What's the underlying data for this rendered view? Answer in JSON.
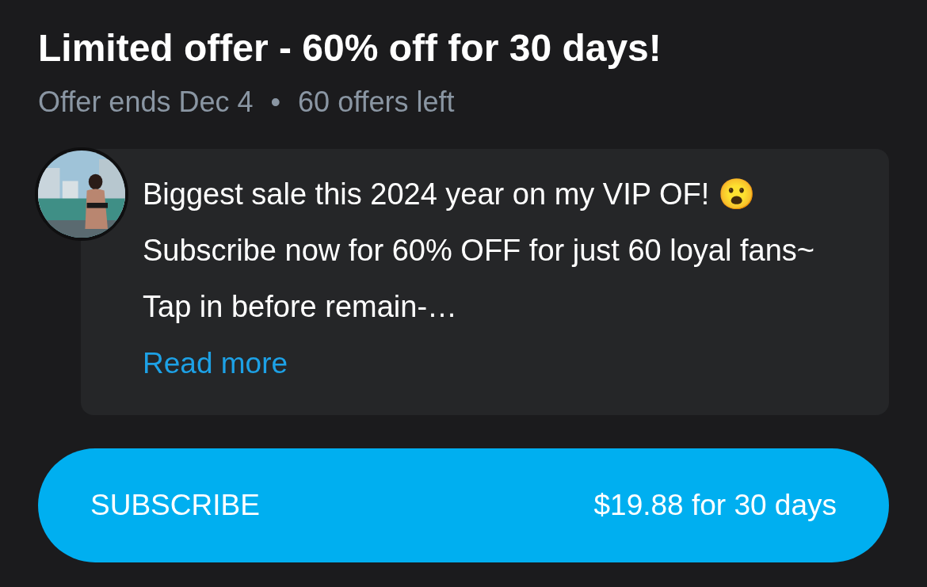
{
  "offer": {
    "title": "Limited offer - 60% off for 30 days!",
    "ends": "Offer ends Dec 4",
    "separator": "•",
    "remaining": "60 offers left"
  },
  "message": {
    "text": "Biggest sale this 2024 year on my VIP OF! 😮 Subscribe now for 60% OFF for just 60 loyal fans~ Tap in before remain-…",
    "link": "Read more"
  },
  "subscribe_button": {
    "label": "SUBSCRIBE",
    "price": "$19.88 for 30 days"
  }
}
